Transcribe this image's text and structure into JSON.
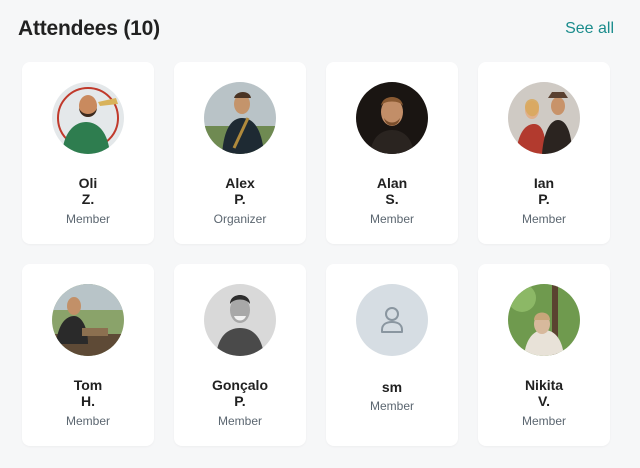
{
  "header": {
    "title": "Attendees (10)",
    "see_all": "See all"
  },
  "attendees": [
    {
      "first": "Oli",
      "last": "Z.",
      "role": "Member",
      "avatar": "photo-man-green-jacket"
    },
    {
      "first": "Alex",
      "last": "P.",
      "role": "Organizer",
      "avatar": "photo-man-outdoors"
    },
    {
      "first": "Alan",
      "last": "S.",
      "role": "Member",
      "avatar": "photo-man-dark-background"
    },
    {
      "first": "Ian",
      "last": "P.",
      "role": "Member",
      "avatar": "photo-couple-costume"
    },
    {
      "first": "Tom",
      "last": "H.",
      "role": "Member",
      "avatar": "photo-man-field"
    },
    {
      "first": "Gonçalo",
      "last": "P.",
      "role": "Member",
      "avatar": "photo-man-smiling-bw"
    },
    {
      "first": "sm",
      "last": "",
      "role": "Member",
      "avatar": "default-person-icon"
    },
    {
      "first": "Nikita",
      "last": "V.",
      "role": "Member",
      "avatar": "photo-person-trees"
    }
  ],
  "colors": {
    "accent": "#1a8c8c",
    "background": "#f6f7f8",
    "card": "#ffffff",
    "placeholder_avatar": "#d6dde3"
  }
}
